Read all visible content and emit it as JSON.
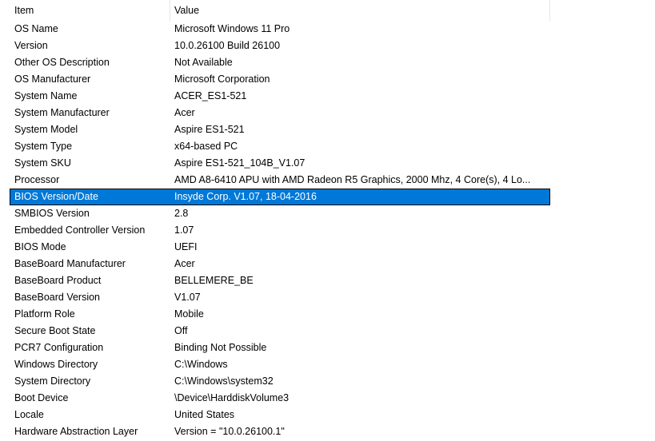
{
  "header": {
    "item_label": "Item",
    "value_label": "Value"
  },
  "rows": [
    {
      "item": "OS Name",
      "value": "Microsoft Windows 11 Pro"
    },
    {
      "item": "Version",
      "value": "10.0.26100 Build 26100"
    },
    {
      "item": "Other OS Description",
      "value": "Not Available"
    },
    {
      "item": "OS Manufacturer",
      "value": "Microsoft Corporation"
    },
    {
      "item": "System Name",
      "value": "ACER_ES1-521"
    },
    {
      "item": "System Manufacturer",
      "value": "Acer"
    },
    {
      "item": "System Model",
      "value": "Aspire ES1-521"
    },
    {
      "item": "System Type",
      "value": "x64-based PC"
    },
    {
      "item": "System SKU",
      "value": "Aspire ES1-521_104B_V1.07"
    },
    {
      "item": "Processor",
      "value": "AMD A8-6410 APU with AMD Radeon R5 Graphics, 2000 Mhz, 4 Core(s), 4 Lo..."
    },
    {
      "item": "BIOS Version/Date",
      "value": "Insyde Corp. V1.07, 18-04-2016",
      "selected": true
    },
    {
      "item": "SMBIOS Version",
      "value": "2.8"
    },
    {
      "item": "Embedded Controller Version",
      "value": "1.07"
    },
    {
      "item": "BIOS Mode",
      "value": "UEFI"
    },
    {
      "item": "BaseBoard Manufacturer",
      "value": "Acer"
    },
    {
      "item": "BaseBoard Product",
      "value": "BELLEMERE_BE"
    },
    {
      "item": "BaseBoard Version",
      "value": "V1.07"
    },
    {
      "item": "Platform Role",
      "value": "Mobile"
    },
    {
      "item": "Secure Boot State",
      "value": "Off"
    },
    {
      "item": "PCR7 Configuration",
      "value": "Binding Not Possible"
    },
    {
      "item": "Windows Directory",
      "value": "C:\\Windows"
    },
    {
      "item": "System Directory",
      "value": "C:\\Windows\\system32"
    },
    {
      "item": "Boot Device",
      "value": "\\Device\\HarddiskVolume3"
    },
    {
      "item": "Locale",
      "value": "United States"
    },
    {
      "item": "Hardware Abstraction Layer",
      "value": "Version = \"10.0.26100.1\""
    }
  ],
  "colors": {
    "selection": "#0078d7",
    "selection_text": "#ffffff"
  }
}
